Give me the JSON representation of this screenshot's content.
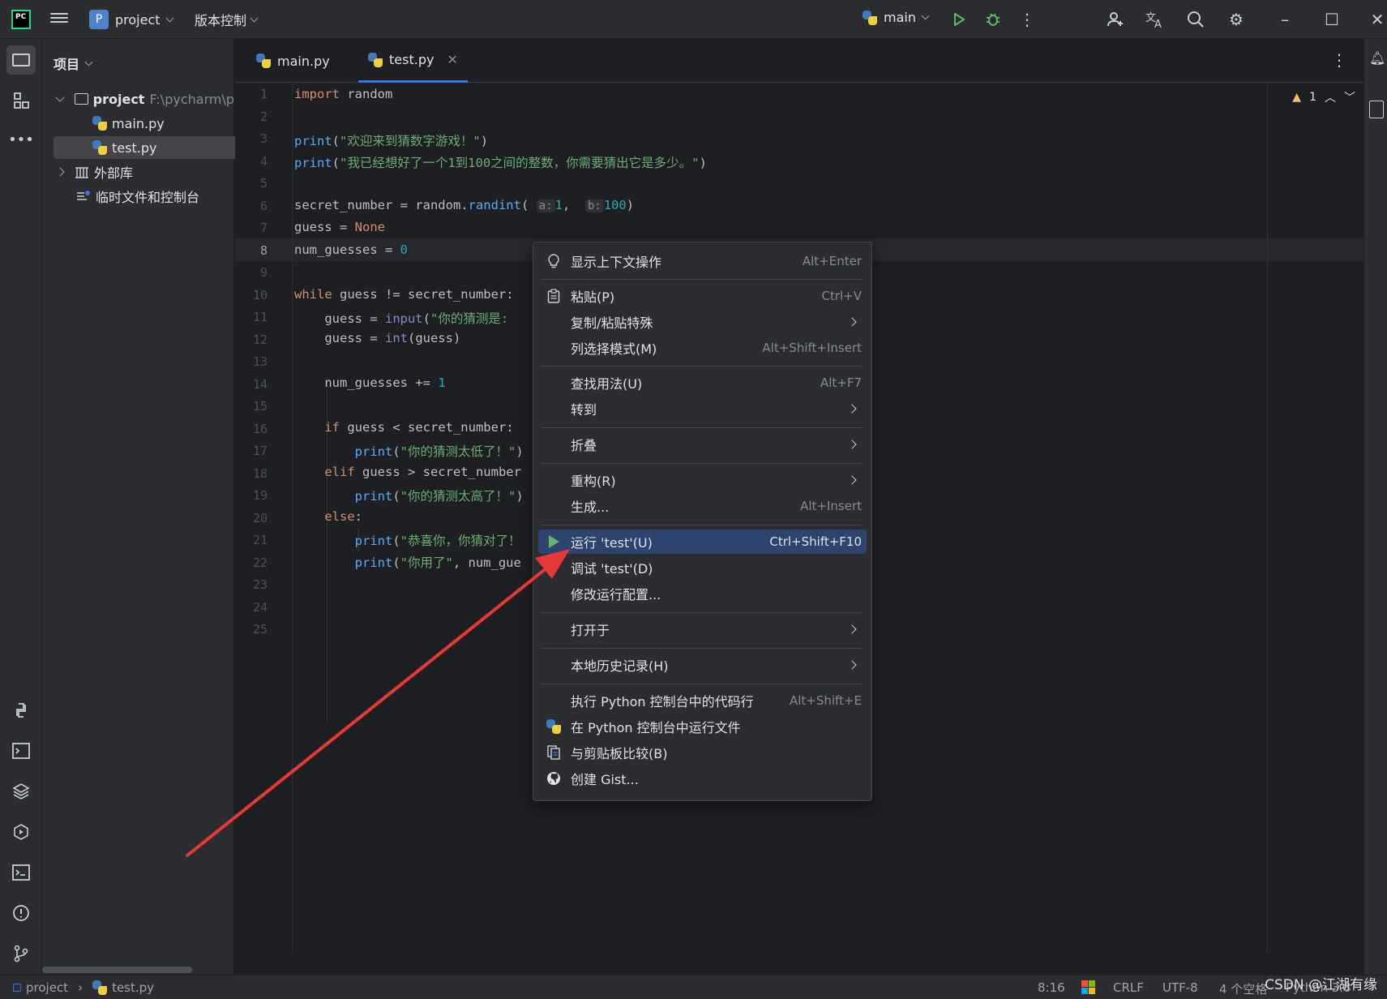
{
  "titlebar": {
    "project_badge": "P",
    "project_name": "project",
    "vcs_label": "版本控制",
    "run_config": "main"
  },
  "project_panel": {
    "header": "项目",
    "root_name": "project",
    "root_path": "F:\\pycharm\\p",
    "files": [
      "main.py",
      "test.py"
    ],
    "external_libs": "外部库",
    "scratches": "临时文件和控制台"
  },
  "tabs": [
    {
      "label": "main.py",
      "active": false
    },
    {
      "label": "test.py",
      "active": true
    }
  ],
  "editor": {
    "line_numbers": [
      "1",
      "2",
      "3",
      "4",
      "5",
      "6",
      "7",
      "8",
      "9",
      "10",
      "11",
      "12",
      "13",
      "14",
      "15",
      "16",
      "17",
      "18",
      "19",
      "20",
      "21",
      "22",
      "23",
      "24",
      "25"
    ],
    "current_line": "8",
    "warning_count": "1",
    "code": {
      "l1_kw": "import",
      "l1_mod": " random",
      "l3_fn": "print",
      "l3_str": "\"欢迎来到猜数字游戏！\"",
      "l4_fn": "print",
      "l4_str": "\"我已经想好了一个1到100之间的整数，你需要猜出它是多少。\"",
      "l6_a": "secret_number = random.",
      "l6_fn": "randint",
      "l6_hint_a": "a:",
      "l6_num_a": "1",
      "l6_hint_b": "b:",
      "l6_num_b": "100",
      "l7_a": "guess = ",
      "l7_kw": "None",
      "l8_a": "num_guesses = ",
      "l8_num": "0",
      "l10_kw": "while",
      "l10_a": " guess != secret_number:",
      "l11_a": "    guess = ",
      "l11_bi": "input",
      "l11_str": "\"你的猜测是:",
      "l12_a": "    guess = ",
      "l12_bi": "int",
      "l12_b": "(guess)",
      "l14_a": "    num_guesses += ",
      "l14_num": "1",
      "l16_kw": "if",
      "l16_a": " guess < secret_number:",
      "l17_fn": "print",
      "l17_str": "\"你的猜测太低了！\"",
      "l18_kw": "elif",
      "l18_a": " guess > secret_number",
      "l19_fn": "print",
      "l19_str": "\"你的猜测太高了！\"",
      "l20_kw": "else",
      "l21_fn": "print",
      "l21_str": "\"恭喜你，你猜对了！",
      "l22_fn": "print",
      "l22_str": "\"你用了\"",
      "l22_a": ", num_gue"
    }
  },
  "context_menu": {
    "items": [
      {
        "label": "显示上下文操作",
        "shortcut": "Alt+Enter",
        "icon": "bulb-icon"
      },
      {
        "label": "粘贴(P)",
        "shortcut": "Ctrl+V",
        "icon": "clipboard-icon"
      },
      {
        "label": "复制/粘贴特殊",
        "shortcut": ""
      },
      {
        "label": "列选择模式(M)",
        "shortcut": "Alt+Shift+Insert"
      },
      {
        "label": "查找用法(U)",
        "shortcut": "Alt+F7"
      },
      {
        "label": "转到",
        "shortcut": ""
      },
      {
        "label": "折叠",
        "shortcut": ""
      },
      {
        "label": "重构(R)",
        "shortcut": ""
      },
      {
        "label": "生成...",
        "shortcut": "Alt+Insert"
      },
      {
        "label": "运行 'test'(U)",
        "shortcut": "Ctrl+Shift+F10",
        "icon": "run-icon",
        "highlighted": true
      },
      {
        "label": "调试 'test'(D)",
        "shortcut": ""
      },
      {
        "label": "修改运行配置...",
        "shortcut": ""
      },
      {
        "label": "打开于",
        "shortcut": ""
      },
      {
        "label": "本地历史记录(H)",
        "shortcut": ""
      },
      {
        "label": "执行 Python 控制台中的代码行",
        "shortcut": "Alt+Shift+E"
      },
      {
        "label": "在 Python 控制台中运行文件",
        "shortcut": "",
        "icon": "python-icon"
      },
      {
        "label": "与剪贴板比较(B)",
        "shortcut": "",
        "icon": "compare-icon"
      },
      {
        "label": "创建 Gist...",
        "shortcut": "",
        "icon": "github-icon"
      }
    ]
  },
  "statusbar": {
    "breadcrumb_project": "project",
    "breadcrumb_file": "test.py",
    "position": "8:16",
    "line_sep": "CRLF",
    "encoding": "UTF-8",
    "indent": "4 个空格",
    "interpreter": "Python 3.8"
  },
  "watermark": "CSDN @江湖有缘",
  "colors": {
    "accent": "#3574f0",
    "highlight": "#2e436e",
    "run_green": "#5fb865",
    "annotation_red": "#e53935"
  }
}
